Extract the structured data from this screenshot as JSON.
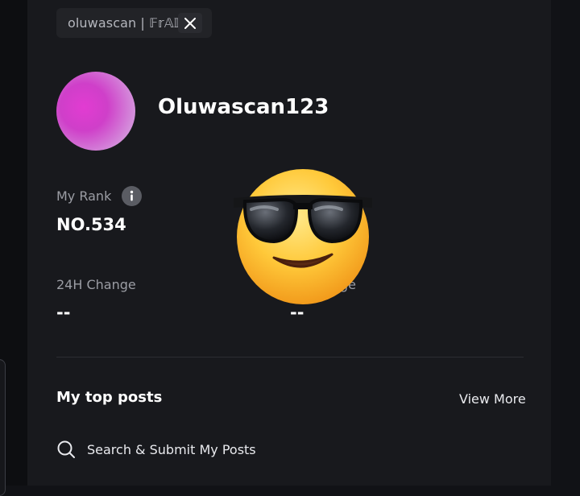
{
  "profile": {
    "handle": "oluwascan | 𝔽𝕣𝔸𝕀",
    "x_icon": "x-logo-icon",
    "username": "Oluwascan123",
    "avatar_colors": [
      "#e23cd2",
      "#d48fdb"
    ]
  },
  "stats": {
    "rank_label": "My Rank",
    "rank_value": "NO.534",
    "info_icon": "info-icon",
    "change_24h_label": "24H Change",
    "change_24h_value": "--",
    "change_7d_label_visible": "ge",
    "change_7d_value": "--"
  },
  "overlay": {
    "emoji_icon": "smiling-face-with-sunglasses-icon"
  },
  "top_posts": {
    "title": "My top posts",
    "view_more": "View More",
    "search_label": "Search & Submit My Posts",
    "search_icon": "search-icon"
  }
}
